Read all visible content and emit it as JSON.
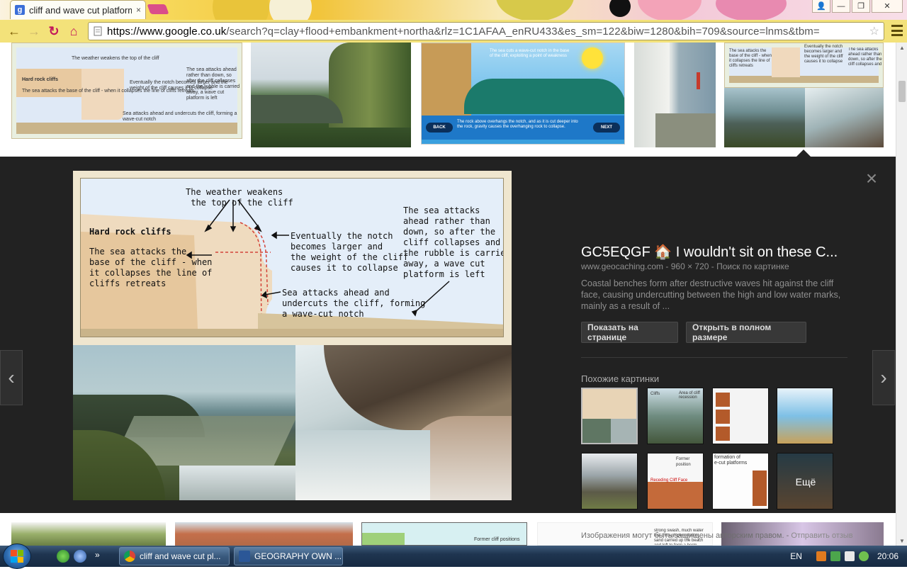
{
  "browser": {
    "tab_title": "cliff and wave cut platform",
    "tab_close": "×",
    "favicon_letter": "g",
    "url_host": "https://www.google.co.uk",
    "url_rest": "/search?q=clay+flood+embankment+northa&rlz=1C1AFAA_enRU433&es_sm=122&biw=1280&bih=709&source=lnms&tbm=",
    "back": "←",
    "forward": "→",
    "reload": "↻",
    "home": "⌂",
    "star": "☆",
    "win_user": "👤",
    "win_min": "—",
    "win_max": "❐",
    "win_close": "✕"
  },
  "diagram": {
    "title": "Hard rock cliffs",
    "weather": "The weather weakens\n the top of the cliff",
    "sea_attacks_base": "The sea attacks the\nbase of the cliff - when\nit collapses the line of\ncliffs retreats",
    "notch": "Eventually the notch\nbecomes larger and\nthe weight of the cliff\ncauses it to collapse",
    "ahead": "The sea attacks\nahead rather than\ndown, so after the\ncliff collapses and\nthe rubble is carried\naway, a wave cut\nplatform is left",
    "undercut": "Sea attacks ahead and\nundercuts the cliff, forming\na wave-cut notch"
  },
  "thumb_wave": {
    "top_text": "The sea cuts a wave-cut notch in the base\nof the cliff, exploiting a point of weakness",
    "bottom_text": "The rock above overhangs the notch, and as it is cut deeper into\nthe rock, gravity causes the overhanging rock to collapse.",
    "back": "BACK",
    "next": "NEXT"
  },
  "thumb_bottom": {
    "former_cliff": "Former cliff positions",
    "swash": "strong swash, much water\nlost through percolation,\nsand carried up the beach\nand left to form a berm"
  },
  "panel": {
    "title": "GC5EQGF 🏠 I wouldn't sit on these C...",
    "meta": "www.geocaching.com - 960 × 720 - Поиск по картинке",
    "description": "Coastal benches form after destructive waves hit against the cliff face, causing undercutting between the high and low water marks, mainly as a result of ...",
    "btn_page": "Показать на странице",
    "btn_full": "Открыть в полном размере",
    "similar_label": "Похожие картинки",
    "more_label": "Ещё",
    "copyright": "Изображения могут быть защищены авторским правом.",
    "feedback": "Отправить отзыв",
    "close": "×",
    "prev": "‹",
    "next": "›"
  },
  "similar": {
    "cliffs_label": "Cliffs",
    "area_label": "Area of cliff\nrecession",
    "former_label": "Former position",
    "receding_label": "Receding Cliff Face",
    "formation_label": "formation of\ne-cut platforms"
  },
  "taskbar": {
    "task1": "cliff and wave cut pl...",
    "task2": "GEOGRAPHY OWN ...",
    "lang": "EN",
    "time": "20:06",
    "show_hidden": "»"
  }
}
